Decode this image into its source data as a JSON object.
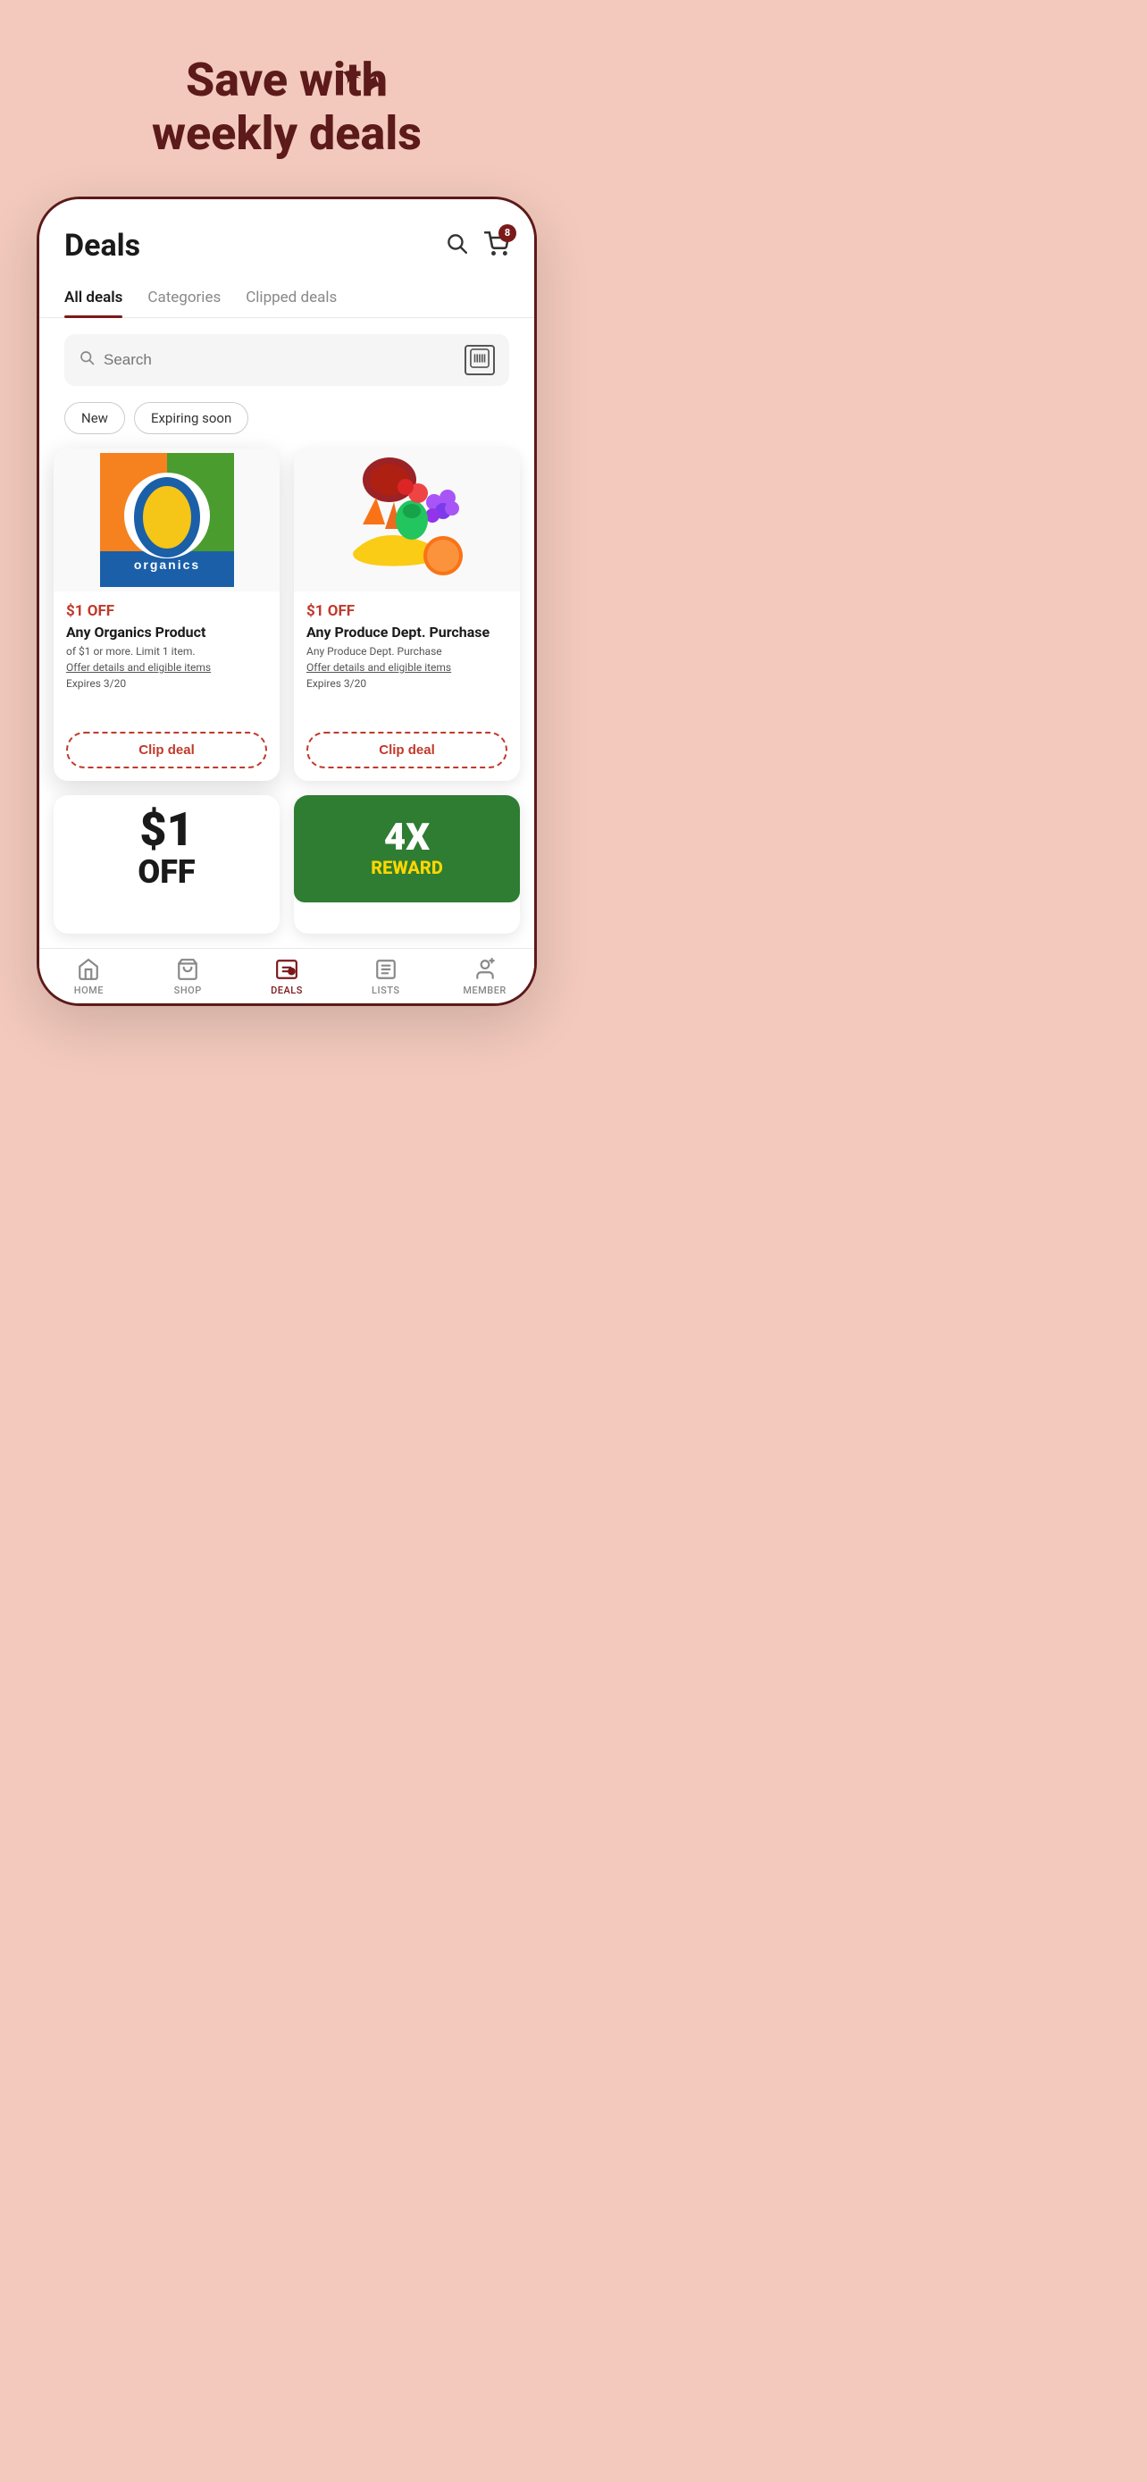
{
  "hero": {
    "title": "Save with\nweekly deals"
  },
  "header": {
    "title": "Deals",
    "cart_count": "8"
  },
  "tabs": [
    {
      "label": "All deals",
      "active": true
    },
    {
      "label": "Categories",
      "active": false
    },
    {
      "label": "Clipped deals",
      "active": false
    }
  ],
  "search": {
    "placeholder": "Search"
  },
  "filter_chips": [
    {
      "label": "New",
      "active": false
    },
    {
      "label": "Expiring soon",
      "active": false
    }
  ],
  "deals": [
    {
      "id": "organics",
      "discount": "$1 OFF",
      "name": "Any Organics Product",
      "desc": "of $1 or more. Limit 1 item.",
      "link_text": "Offer details and eligible items",
      "expires": "Expires 3/20",
      "clip_label": "Clip deal"
    },
    {
      "id": "produce",
      "discount": "$1 OFF",
      "name": "Any Produce Dept. Purchase",
      "desc": "Any Produce Dept. Purchase",
      "link_text": "Offer details and eligible items",
      "expires": "Expires 3/20",
      "clip_label": "Clip deal"
    }
  ],
  "partial_deals": [
    {
      "big_price": "$1",
      "big_off": "OFF"
    },
    {
      "reward": "4X",
      "reward_sub": "REWARD"
    }
  ],
  "bottom_nav": [
    {
      "label": "HOME",
      "active": false,
      "icon": "🏠"
    },
    {
      "label": "SHOP",
      "active": false,
      "icon": "🛍"
    },
    {
      "label": "DEALS",
      "active": true,
      "icon": "🏷"
    },
    {
      "label": "LISTS",
      "active": false,
      "icon": "📋"
    },
    {
      "label": "MEMBER",
      "active": false,
      "icon": "👤"
    }
  ]
}
